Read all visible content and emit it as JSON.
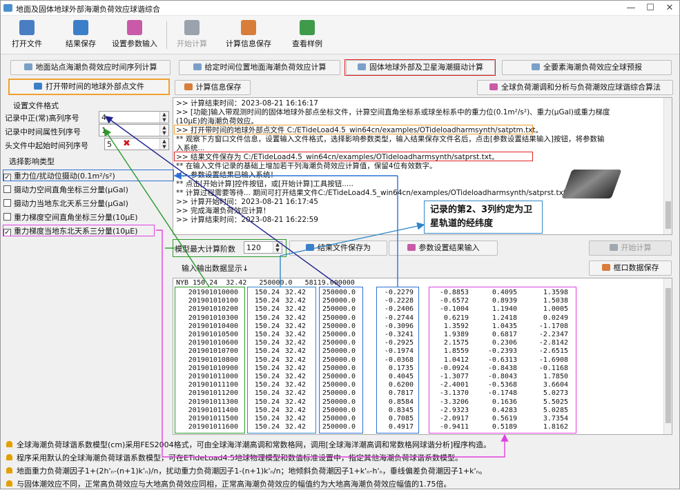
{
  "window": {
    "title": "地面及固体地球外部海潮负荷效应球谐综合",
    "controls": [
      "—",
      "☐",
      "✕"
    ]
  },
  "toolbar": [
    {
      "label": "打开文件",
      "icon": "open-file-icon",
      "color": "#4a7ec2",
      "disabled": false
    },
    {
      "label": "结果保存",
      "icon": "save-icon",
      "color": "#3b7fc8",
      "disabled": false
    },
    {
      "label": "设置参数输入",
      "icon": "settings-input-icon",
      "color": "#c85aa8",
      "disabled": false
    },
    {
      "label": "开始计算",
      "icon": "start-compute-icon",
      "color": "#9aa3ad",
      "disabled": true
    },
    {
      "label": "计算信息保存",
      "icon": "info-save-icon",
      "color": "#d87d3a",
      "disabled": false
    },
    {
      "label": "查看样例",
      "icon": "view-sample-icon",
      "color": "#3f9a4a",
      "disabled": false
    }
  ],
  "mode_buttons": [
    "地面站点海潮负荷效应时间序列计算",
    "给定时间位置地面海潮负荷效应计算",
    "固体地球外部及卫星海潮摄动计算",
    "全要素海潮负荷效应全球预报"
  ],
  "open_file_btn": "打开带时间的地球外部点文件",
  "save_info_btn": "计算信息保存",
  "global_algo_btn": "全球负荷潮调和分析与负荷潮效应球谐综合算法",
  "left": {
    "format_title": "设置文件格式",
    "fields": [
      {
        "label": "记录中正(常)高列序号",
        "value": "4",
        "mark": ""
      },
      {
        "label": "记录中时间属性列序号",
        "value": "1",
        "mark": ""
      },
      {
        "label": "头文件中起始时间列序号",
        "value": "5",
        "mark": "✖"
      }
    ],
    "type_title": "选择影响类型",
    "checks": [
      {
        "label": "重力位/扰动位摄动(0.1m²/s²)",
        "checked": true
      },
      {
        "label": "摄动力空间直角坐标三分量(μGal)",
        "checked": false
      },
      {
        "label": "摄动力当地东北天系三分量(μGal)",
        "checked": false
      },
      {
        "label": "重力梯度空间直角坐标三分量(10μE)",
        "checked": false
      },
      {
        "label": "重力梯度当地东北天系三分量(10μE)",
        "checked": true
      }
    ]
  },
  "log_lines": [
    ">> 计算结束时间：2023-08-21 16:16:17",
    ">> [功能]输入带观测时间的固体地球外部点坐标文件，计算空间直角坐标系或球坐标系中的重力位(0.1m²/s²)、重力(μGal)或重力梯度",
    "(10μE)的海潮负荷效应。",
    ">> 打开带时间的地球外部点文件 C:/ETideLoad4.5_win64cn/examples/OTideloadharmsynth/satptm.txt。",
    "   ** 观察下方窗口文件信息，设置输入文件格式，选择影响参数类型，输入结果保存文件名后，点击[参数设置结果输入]按钮，将参数输",
    "入系统...",
    ">> 结果文件保存为 C:/ETideLoad4.5_win64cn/examples/OTideloadharmsynth/satprst.txt。",
    "   ** 在输入文件记录的基础上增加若干列海潮负荷效应计算值，保留4位有效数字。",
    ">> 参数设置结果已输入系统！",
    "   ** 点击[开始计算]控件按钮，或[开始计算]工具按钮.....",
    "   ** 计算过程需要等待... 期间可打开结果文件C:/ETideLoad4.5_win64cn/examples/OTideloadharmsynth/satprst.txt查看计算进度!",
    ">> 计算开始时间：2023-08-21 16:17:45",
    ">> 完成海潮负荷效应计算！",
    ">> 计算结束时间：2023-08-21 16:22:59"
  ],
  "callout": "记录的第2、3列约定为卫星轨道的经纬度",
  "degree_label": "模型最大计算阶数",
  "degree_value": "120",
  "save_result_btn": "结果文件保存为",
  "param_input_btn": "参数设置结果输入",
  "start_btn": "开始计算",
  "io_label": "输入输出数据显示↓",
  "frame_save_btn": "框口数据保存",
  "table": {
    "header": "NYB 150.24  32.42   250000.0   58119.000000",
    "rows": [
      [
        "201901010000",
        "150.24",
        "32.42",
        "250000.0",
        "-0.2279",
        "-0.8853",
        "0.4095",
        "1.3598"
      ],
      [
        "201901010100",
        "150.24",
        "32.42",
        "250000.0",
        "-0.2228",
        "-0.6572",
        "0.8939",
        "1.5038"
      ],
      [
        "201901010200",
        "150.24",
        "32.42",
        "250000.0",
        "-0.2406",
        "-0.1004",
        "1.1940",
        "1.0005"
      ],
      [
        "201901010300",
        "150.24",
        "32.42",
        "250000.0",
        "-0.2744",
        "0.6219",
        "1.2418",
        "0.0249"
      ],
      [
        "201901010400",
        "150.24",
        "32.42",
        "250000.0",
        "-0.3096",
        "1.3592",
        "1.0435",
        "-1.1708"
      ],
      [
        "201901010500",
        "150.24",
        "32.42",
        "250000.0",
        "-0.3241",
        "1.9389",
        "0.6817",
        "-2.2347"
      ],
      [
        "201901010600",
        "150.24",
        "32.42",
        "250000.0",
        "-0.2925",
        "2.1575",
        "0.2306",
        "-2.8142"
      ],
      [
        "201901010700",
        "150.24",
        "32.42",
        "250000.0",
        "-0.1974",
        "1.8559",
        "-0.2393",
        "-2.6515"
      ],
      [
        "201901010800",
        "150.24",
        "32.42",
        "250000.0",
        "-0.0368",
        "1.0412",
        "-0.6313",
        "-1.6908"
      ],
      [
        "201901010900",
        "150.24",
        "32.42",
        "250000.0",
        "0.1735",
        "-0.0924",
        "-0.8438",
        "-0.1168"
      ],
      [
        "201901011000",
        "150.24",
        "32.42",
        "250000.0",
        "0.4045",
        "-1.3077",
        "-0.8043",
        "1.7850"
      ],
      [
        "201901011100",
        "150.24",
        "32.42",
        "250000.0",
        "0.6200",
        "-2.4001",
        "-0.5368",
        "3.6604"
      ],
      [
        "201901011200",
        "150.24",
        "32.42",
        "250000.0",
        "0.7817",
        "-3.1370",
        "-0.1748",
        "5.0273"
      ],
      [
        "201901011300",
        "150.24",
        "32.42",
        "250000.0",
        "0.8584",
        "-3.3206",
        "0.1636",
        "5.5025"
      ],
      [
        "201901011400",
        "150.24",
        "32.42",
        "250000.0",
        "0.8345",
        "-2.9323",
        "0.4283",
        "5.0285"
      ],
      [
        "201901011500",
        "150.24",
        "32.42",
        "250000.0",
        "0.7085",
        "-2.0917",
        "0.5619",
        "3.7354"
      ],
      [
        "201901011600",
        "150.24",
        "32.42",
        "250000.0",
        "0.4917",
        "-0.9411",
        "0.5189",
        "1.8162"
      ]
    ]
  },
  "notes": [
    "全球海潮负荷球谐系数模型(cm)采用FES2004格式，可由全球海洋潮高调和常数格网，调用[全球海洋潮高调和常数格网球谐分析]程序构造。",
    "程序采用默认的全球海潮负荷球谐系数模型，可在ETideLoad4.5地球物理模型和数值标准设置中，指定其他海潮负荷球谐系数模型。",
    "地面重力负荷潮因子1+(2h'ₙ-(n+1)k'ₙ)/n，扰动重力负荷潮因子1-(n+1)k'ₙ/n；地倾斜负荷潮因子1+k'ₙ-h'ₙ，垂线偏差负荷潮因子1+k'ₙ。",
    "与固体潮效应不同，正常高负荷效应与大地高负荷效应同相，正常高海潮负荷效应的幅值约为大地高海潮负荷效应幅值的1.75倍。"
  ],
  "colors": {
    "orange": "#f0a030",
    "red": "#e02020",
    "blue": "#2b6fd6",
    "green": "#2a9a2a",
    "magenta": "#e040e0",
    "navy": "#202090",
    "cyan": "#2f86c8"
  }
}
